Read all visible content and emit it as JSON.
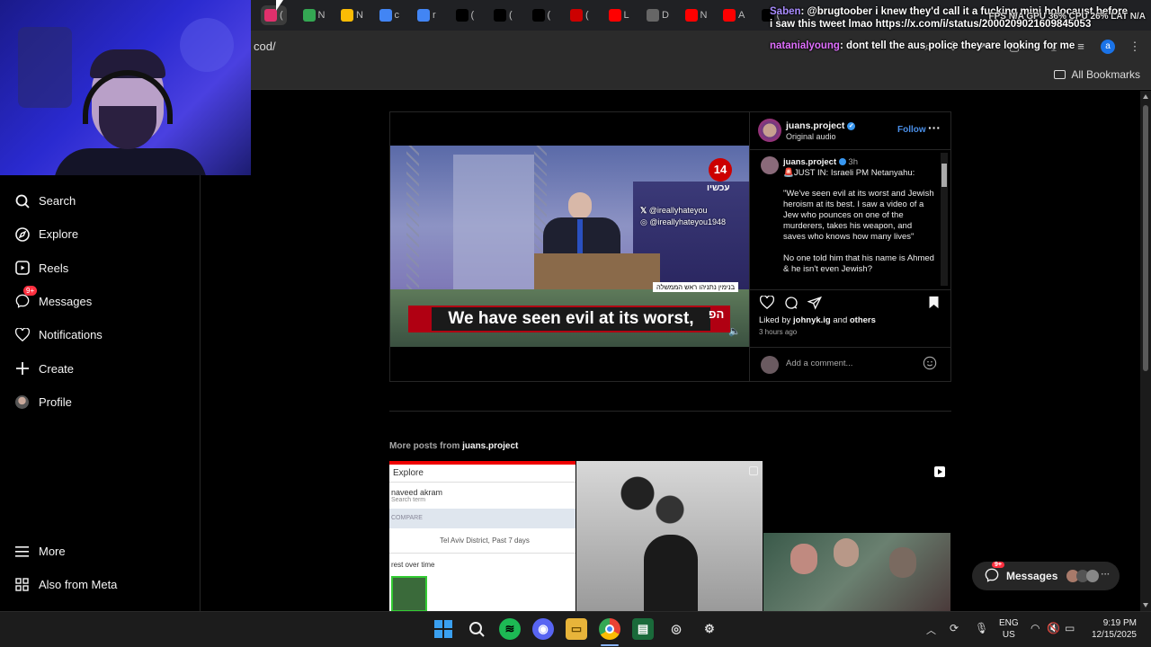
{
  "browser": {
    "url": "cod/",
    "all_bookmarks": "All Bookmarks",
    "tabs": [
      {
        "icon": "instagram-icon",
        "label": "(",
        "color": "#e1306c",
        "active": true
      },
      {
        "icon": "chart-icon",
        "label": "N",
        "color": "#34a853"
      },
      {
        "icon": "chart-icon",
        "label": "N",
        "color": "#fbbc05"
      },
      {
        "icon": "google-icon",
        "label": "c",
        "color": "#4285f4"
      },
      {
        "icon": "google-icon",
        "label": "r",
        "color": "#4285f4"
      },
      {
        "icon": "x-icon",
        "label": "(",
        "color": "#000000"
      },
      {
        "icon": "x-icon",
        "label": "(",
        "color": "#000000"
      },
      {
        "icon": "x-icon",
        "label": "(",
        "color": "#000000"
      },
      {
        "icon": "cnn-icon",
        "label": "(",
        "color": "#cc0000"
      },
      {
        "icon": "youtube-icon",
        "label": "L",
        "color": "#ff0000"
      },
      {
        "icon": "building-icon",
        "label": "D",
        "color": "#666666"
      },
      {
        "icon": "youtube-icon",
        "label": "N",
        "color": "#ff0000"
      },
      {
        "icon": "youtube-icon",
        "label": "A",
        "color": "#ff0000"
      },
      {
        "icon": "x-icon",
        "label": "(",
        "color": "#000000"
      }
    ]
  },
  "stream_overlay": {
    "stats": "FPS N/A  GPU 36%  CPU 26%  LAT N/A",
    "chat": [
      {
        "user": "Saben",
        "text": ": @brugtoober i knew they'd call it a fucking mini holocaust before i saw this tweet lmao",
        "link": "https://x.com/i/status/2000209021609845053"
      },
      {
        "user": "natanialyoung",
        "text": ": dont tell the aus police they are looking for me"
      }
    ]
  },
  "sidebar": {
    "items": [
      {
        "name": "search",
        "icon": "search-icon",
        "label": "Search"
      },
      {
        "name": "explore",
        "icon": "compass-icon",
        "label": "Explore"
      },
      {
        "name": "reels",
        "icon": "reels-icon",
        "label": "Reels"
      },
      {
        "name": "messages",
        "icon": "messenger-icon",
        "label": "Messages",
        "badge": "9+"
      },
      {
        "name": "notifications",
        "icon": "heart-icon",
        "label": "Notifications"
      },
      {
        "name": "create",
        "icon": "plus-icon",
        "label": "Create"
      },
      {
        "name": "profile",
        "icon": "avatar-icon",
        "label": "Profile"
      }
    ],
    "more": "More",
    "also_from_meta": "Also from Meta"
  },
  "post": {
    "username": "juans.project",
    "subtitle": "Original audio",
    "follow": "Follow",
    "video": {
      "channel_badge": "14",
      "channel_sub": "עכשיו",
      "watermark_x": "@ireallyhateyou",
      "watermark_ig": "@ireallyhateyou1948",
      "lower_third": "בנימין נתניהו ראש הממשלה",
      "subtitle": "We have seen evil at its worst,",
      "corner": "הפ"
    },
    "caption_user": "juans.project",
    "caption_time": "3h",
    "caption_lines": [
      "🚨JUST IN: Israeli PM Netanyahu:",
      "\"We've seen evil at its worst and Jewish heroism at its best. I saw a video of a Jew who pounces on one of the murderers, takes his weapon, and saves who knows how many lives\"",
      "No one told him that his name is Ahmed & he isn't even Jewish?"
    ],
    "liked_by_prefix": "Liked by",
    "liked_by_user": "johnyk.ig",
    "liked_by_and": "and",
    "liked_by_others": "others",
    "time_ago": "3 hours ago",
    "comment_placeholder": "Add a comment..."
  },
  "more_posts": {
    "prefix": "More posts from",
    "user": "juans.project",
    "thumb1": {
      "title": "Explore",
      "name": "naveed akram",
      "hint": "Search term",
      "compare": "COMPARE",
      "filter": "Tel Aviv District, Past 7 days",
      "interest": "rest over time"
    }
  },
  "messages_pill": {
    "label": "Messages",
    "badge": "9+"
  },
  "taskbar": {
    "lang": "ENG",
    "region": "US",
    "time": "9:19 PM",
    "date": "12/15/2025"
  }
}
